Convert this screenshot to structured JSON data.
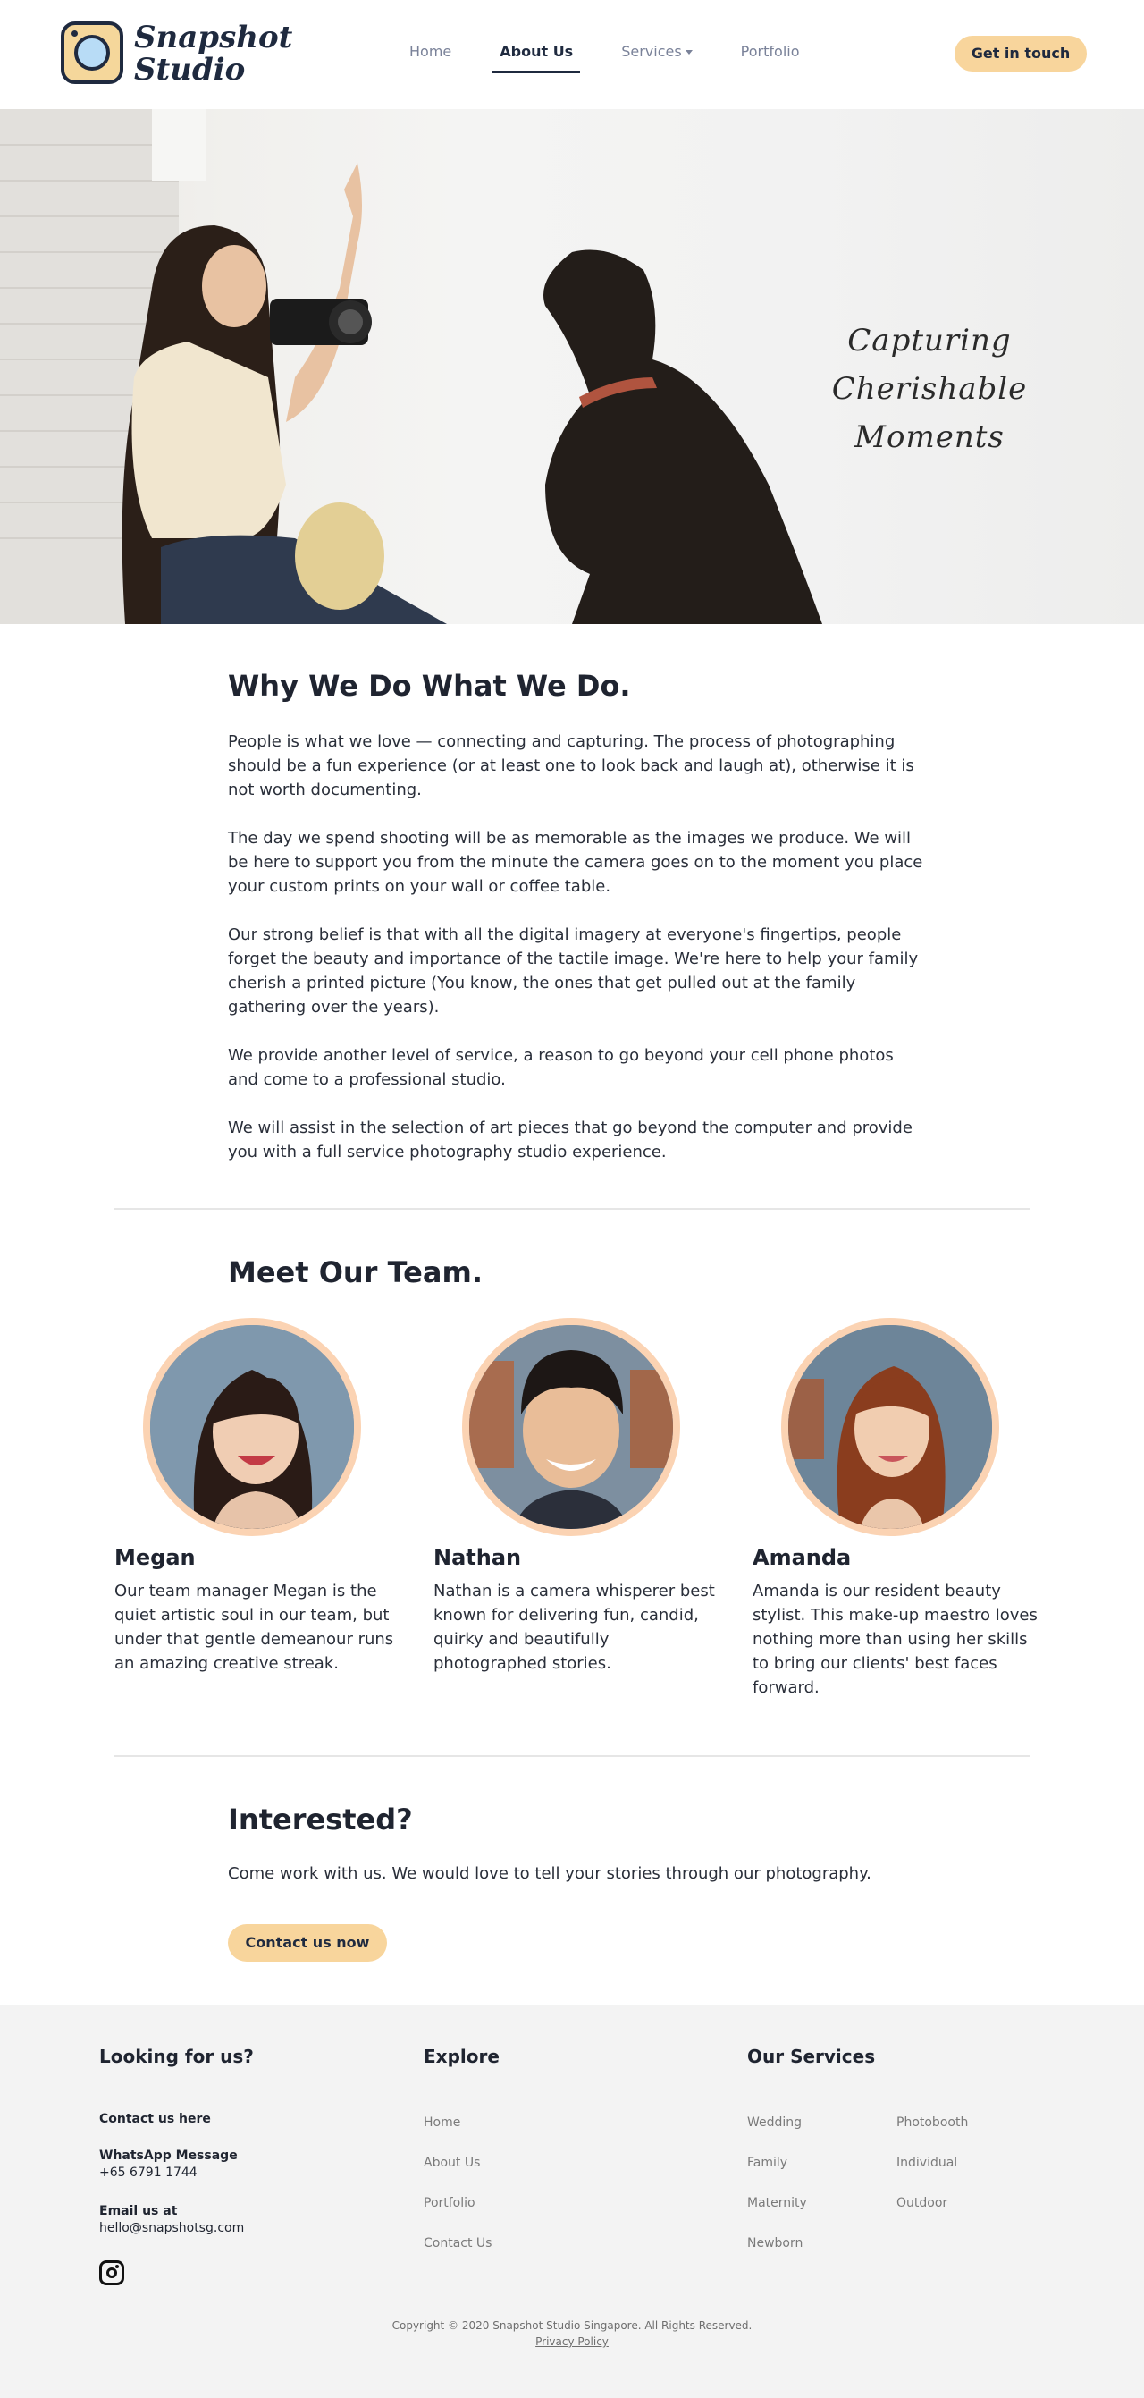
{
  "header": {
    "logo_line1": "Snapshot",
    "logo_line2": "Studio",
    "nav": [
      {
        "label": "Home"
      },
      {
        "label": "About Us"
      },
      {
        "label": "Services"
      },
      {
        "label": "Portfolio"
      }
    ],
    "cta_label": "Get in touch"
  },
  "hero": {
    "tagline_line1": "Capturing Cherishable",
    "tagline_line2": "Moments"
  },
  "why": {
    "title": "Why We Do What We Do.",
    "paragraphs": [
      "People is what we love — connecting and capturing. The process of photographing should be a fun experience (or at least one to look back and laugh at), otherwise it is not worth documenting.",
      "The day we spend shooting will be as memorable as the images we produce. We will be here to support you from the minute the camera goes on to the moment you place your custom prints on your wall or coffee table.",
      "Our strong belief is that with all the digital imagery at everyone's fingertips, people forget the beauty and importance of the tactile image. We're here to help your family cherish a printed picture (You know, the ones that get pulled out at the family gathering over the years).",
      "We provide another level of service, a reason to go beyond your cell phone photos and come to a professional studio.",
      "We will assist in the selection of art pieces that go beyond the computer and provide you with a full service photography studio experience."
    ]
  },
  "team": {
    "title": "Meet Our Team.",
    "members": [
      {
        "name": "Megan",
        "bio": "Our team manager Megan is the quiet artistic soul in our team, but under that gentle demeanour runs an amazing creative streak."
      },
      {
        "name": "Nathan",
        "bio": "Nathan is a camera whisperer best known for delivering fun, candid, quirky and beautifully photographed stories."
      },
      {
        "name": "Amanda",
        "bio": "Amanda is our resident beauty stylist. This make-up maestro loves nothing more than using her skills to bring our clients' best faces forward."
      }
    ]
  },
  "interested": {
    "title": "Interested?",
    "text": "Come work with us. We would love to tell your stories through our photography.",
    "button": "Contact us now"
  },
  "footer": {
    "col1_title": "Looking for us?",
    "contact_label": "Contact us",
    "contact_link": "here",
    "whatsapp_label": "WhatsApp Message",
    "whatsapp_value": "+65 6791 1744",
    "email_label": "Email us at",
    "email_value": "hello@snapshotsg.com",
    "col2_title": "Explore",
    "explore": [
      "Home",
      "About Us",
      "Portfolio",
      "Contact Us"
    ],
    "col3_title": "Our Services",
    "services_a": [
      "Wedding",
      "Family",
      "Maternity",
      "Newborn"
    ],
    "services_b": [
      "Photobooth",
      "Individual",
      "Outdoor"
    ],
    "copyright": "Copyright © 2020 Snapshot Studio Singapore. All Rights Reserved.",
    "privacy": "Privacy Policy"
  },
  "colors": {
    "accent": "#f8d59c",
    "navy": "#1f2a3f",
    "avatar_ring": "#fbd3b3",
    "footer_bg": "#f3f3f3"
  }
}
